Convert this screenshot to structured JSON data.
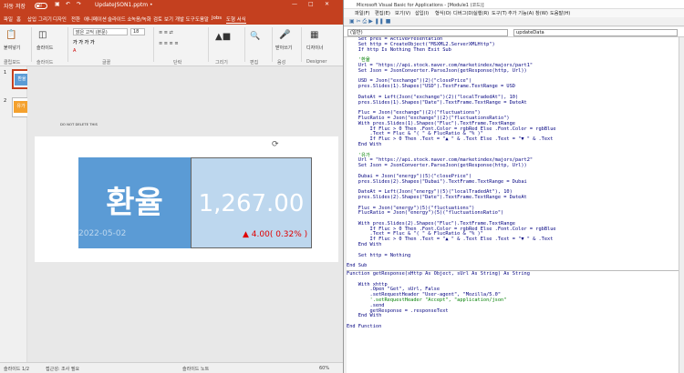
{
  "ppt": {
    "autosave_label": "자동 저장",
    "autosave_state": "끔",
    "title": "UpdateJSON1.pptm •",
    "search_hint": "검색",
    "tabs": [
      "파일",
      "홈",
      "삽입",
      "그리기",
      "디자인",
      "전환",
      "애니메이션",
      "슬라이드 쇼",
      "녹음/녹화",
      "검토",
      "보기",
      "개발 도구",
      "도움말",
      "Jobs",
      "도형 서식"
    ],
    "ribbon": {
      "paste": "붙여넣기",
      "new_slide": "슬라이드",
      "font_name": "맑은 고딕 (본문)",
      "font_size": "18",
      "clipboard": "클립보드",
      "slide_group": "슬라이드",
      "font_group": "글꼴",
      "paragraph_group": "단락",
      "drawing": "그리기",
      "editing": "편집",
      "voice": "받아쓰기",
      "voice_group": "음성",
      "designer": "디자이너",
      "designer_group": "Designer"
    },
    "thumbs": [
      {
        "num": "1",
        "a": "환율",
        "b": "1,267"
      },
      {
        "num": "2",
        "a": "유가",
        "b": ""
      }
    ],
    "slide": {
      "note": "DO NOT DELETE THIS",
      "word": "환율",
      "rate": "1,267.00",
      "date": "2022-05-02",
      "change": "▲ 4.00( 0.32% )"
    },
    "status": {
      "slide": "슬라이드 1/2",
      "accessibility": "접근성: 조사 필요",
      "notes": "슬라이드 노트",
      "zoom": "60%"
    }
  },
  "vba": {
    "title": "Microsoft Visual Basic for Applications - [Module1 (코드)]",
    "menu": [
      "파일(F)",
      "편집(E)",
      "보기(V)",
      "삽입(I)",
      "형식(O)",
      "디버그(D)",
      "실행(R)",
      "도구(T)",
      "추가 기능(A)",
      "창(W)",
      "도움말(H)"
    ],
    "combo_left": "(일반)",
    "combo_right": "updateData",
    "code": [
      {
        "t": "    Set pres = ActivePresentation"
      },
      {
        "t": "    Set http = CreateObject(\"MSXML2.ServerXMLHttp\")"
      },
      {
        "t": "    If http Is Nothing Then Exit Sub"
      },
      {
        "t": ""
      },
      {
        "t": "    '환율",
        "c": true
      },
      {
        "t": "    Url = \"https://api.stock.naver.com/marketindex/majors/part1\""
      },
      {
        "t": "    Set Json = JsonConverter.ParseJson(getResponse(http, Url))"
      },
      {
        "t": ""
      },
      {
        "t": "    USD = Json(\"exchange\")(2)(\"closePrice\")"
      },
      {
        "t": "    pres.Slides(1).Shapes(\"USD\").TextFrame.TextRange = USD"
      },
      {
        "t": ""
      },
      {
        "t": "    DateAt = Left(Json(\"exchange\")(2)(\"localTradedAt\"), 10)"
      },
      {
        "t": "    pres.Slides(1).Shapes(\"Date\").TextFrame.TextRange = DateAt"
      },
      {
        "t": ""
      },
      {
        "t": "    Fluc = Json(\"exchange\")(2)(\"fluctuations\")"
      },
      {
        "t": "    FlucRatio = Json(\"exchange\")(2)(\"fluctuationsRatio\")"
      },
      {
        "t": "    With pres.Slides(1).Shapes(\"Fluc\").TextFrame.TextRange"
      },
      {
        "t": "        If Fluc > 0 Then .Font.Color = rgbRed Else .Font.Color = rgbBlue"
      },
      {
        "t": "        .Text = Fluc & \"( \" & FlucRatio & \"% )\""
      },
      {
        "t": "        If Fluc > 0 Then .Text = \"▲ \" & .Text Else .Text = \"▼ \" & .Text"
      },
      {
        "t": "    End With"
      },
      {
        "t": ""
      },
      {
        "t": "    '유가",
        "c": true
      },
      {
        "t": "    Url = \"https://api.stock.naver.com/marketindex/majors/part2\""
      },
      {
        "t": "    Set Json = JsonConverter.ParseJson(getResponse(http, Url))"
      },
      {
        "t": ""
      },
      {
        "t": "    Dubai = Json(\"energy\")(5)(\"closePrice\")"
      },
      {
        "t": "    pres.Slides(2).Shapes(\"Dubai\").TextFrame.TextRange = Dubai"
      },
      {
        "t": ""
      },
      {
        "t": "    DateAt = Left(Json(\"energy\")(5)(\"localTradedAt\"), 10)"
      },
      {
        "t": "    pres.Slides(2).Shapes(\"Date\").TextFrame.TextRange = DateAt"
      },
      {
        "t": ""
      },
      {
        "t": "    Fluc = Json(\"energy\")(5)(\"fluctuations\")"
      },
      {
        "t": "    FlucRatio = Json(\"energy\")(5)(\"fluctuationsRatio\")"
      },
      {
        "t": ""
      },
      {
        "t": "    With pres.Slides(2).Shapes(\"Fluc\").TextFrame.TextRange"
      },
      {
        "t": "        If Fluc > 0 Then .Font.Color = rgbRed Else .Font.Color = rgbBlue"
      },
      {
        "t": "        .Text = Fluc & \"( \" & FlucRatio & \"% )\""
      },
      {
        "t": "        If Fluc > 0 Then .Text = \"▲ \" & .Text Else .Text = \"▼ \" & .Text"
      },
      {
        "t": "    End With"
      },
      {
        "t": ""
      },
      {
        "t": "    Set http = Nothing"
      },
      {
        "t": ""
      },
      {
        "t": "End Sub"
      },
      {
        "hr": true
      },
      {
        "t": "Function getResponse(xHttp As Object, sUrl As String) As String"
      },
      {
        "t": ""
      },
      {
        "t": "    With xhttp"
      },
      {
        "t": "        .Open \"Get\", sUrl, False"
      },
      {
        "t": "        .setRequestHeader \"User-agent\", \"Mozilla/5.0\""
      },
      {
        "t": "        '.setRequestHeader \"Accept\", \"application/json\"",
        "c": true
      },
      {
        "t": "        .send"
      },
      {
        "t": "        getResponse = .responseText"
      },
      {
        "t": "    End With"
      },
      {
        "t": ""
      },
      {
        "t": "End Function"
      }
    ]
  },
  "colors": {
    "ppt_accent": "#c4401f",
    "tile_dark": "#5b9bd5",
    "tile_light": "#bdd7ee",
    "red": "#e00000"
  }
}
